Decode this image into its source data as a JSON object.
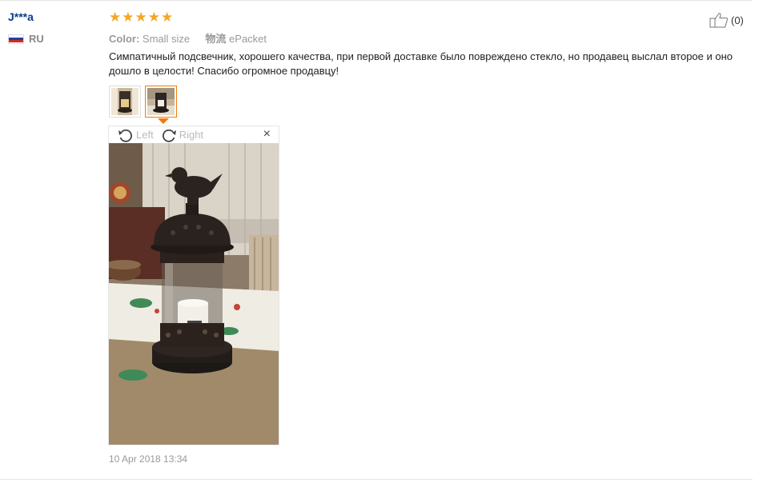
{
  "review": {
    "user_name": "J***a",
    "country_code": "RU",
    "rating": 5,
    "rating_stars": [
      "★",
      "★",
      "★",
      "★",
      "★"
    ],
    "color_label": "Color:",
    "color_value": "Small size",
    "shipping_label": "物流",
    "shipping_value": "ePacket",
    "text": "Симпатичный подсвечник, хорошего качества, при первой доставке было повреждено стекло, но продавец выслал второе и оно дошло в целости! Спасибо огромное продавцу!",
    "helpful_count": "(0)",
    "date": "10 Apr 2018 13:34"
  },
  "viewer": {
    "rotate_left_label": "Left",
    "rotate_right_label": "Right",
    "close_symbol": "×"
  },
  "icons": {
    "helpful": "thumbs-up-icon",
    "rotate_left": "rotate-left-icon",
    "rotate_right": "rotate-right-icon",
    "close": "close-icon",
    "flag": "russia-flag-icon"
  },
  "colors": {
    "username": "#0d3d8c",
    "star": "#f5a623",
    "active_thumb_border": "#f07b0f",
    "flag_white": "#ffffff",
    "flag_blue": "#1c3faa",
    "flag_red": "#d52b1e"
  }
}
